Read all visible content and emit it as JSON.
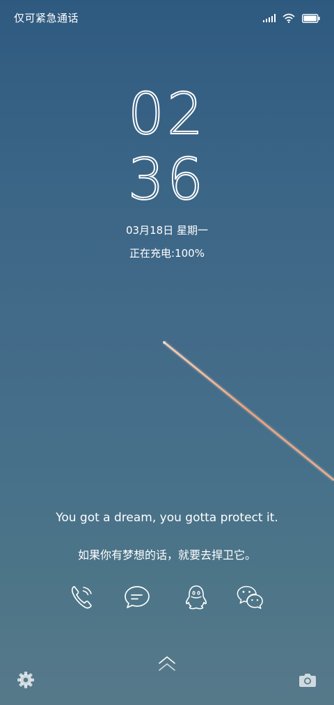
{
  "status_bar": {
    "carrier_text": "仅可紧急通话",
    "icons": [
      "signal-icon",
      "wifi-icon",
      "battery-icon"
    ],
    "battery_level": 1.0
  },
  "clock": {
    "hours": "02",
    "minutes": "36"
  },
  "date": {
    "text": "03月18日 星期一"
  },
  "charging": {
    "text": "正在充电:100%"
  },
  "quote": {
    "english": "You got a dream, you gotta protect it.",
    "chinese": "如果你有梦想的话，就要去捍卫它。"
  },
  "shortcuts": [
    "phone-icon",
    "message-icon",
    "qq-icon",
    "wechat-icon"
  ],
  "bottom": {
    "left_icon": "settings-gear-icon",
    "center_icon": "swipe-up-chevron-icon",
    "right_icon": "camera-icon"
  },
  "colors": {
    "sky_top": "#2f5a80",
    "sky_bottom": "#57798a",
    "contrail": "#f0a27a"
  }
}
